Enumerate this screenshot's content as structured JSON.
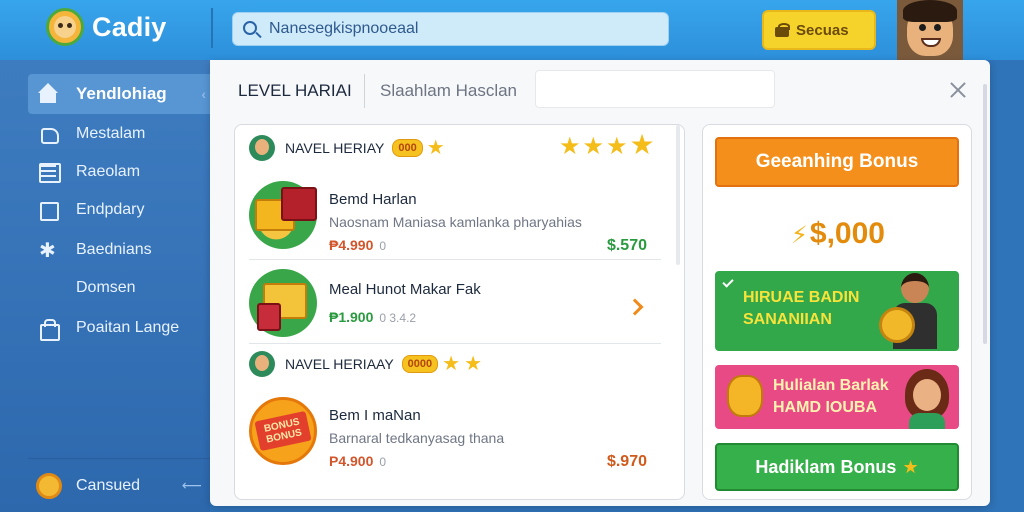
{
  "header": {
    "app_title": "Cadiy",
    "search_value": "Nanesegkispnooeaal",
    "bonus_label": "Secuas",
    "icons": [
      "app-logo-icon",
      "search-icon",
      "gift-icon",
      "avatar"
    ]
  },
  "sidebar": {
    "items": [
      {
        "label": "Yendlohiag",
        "icon": "home-icon",
        "active": true
      },
      {
        "label": "Mestalam",
        "icon": "hand-icon",
        "active": false
      },
      {
        "label": "Raeolam",
        "icon": "list-icon",
        "active": false
      },
      {
        "label": "Endpdary",
        "icon": "square-icon",
        "active": false
      },
      {
        "label": "Baednians",
        "icon": "star-icon",
        "active": false
      },
      {
        "label": "Domsen",
        "icon": "",
        "active": false
      },
      {
        "label": "Poaitan Lange",
        "icon": "bag-icon",
        "active": false
      }
    ],
    "footer_label": "Cansued"
  },
  "dialog": {
    "tabs": [
      {
        "label": "LEVEL HARIAI",
        "active": true
      },
      {
        "label": "Slaahlam Hasclan",
        "active": false
      }
    ]
  },
  "offers_panel": {
    "level_1": {
      "label": "NAVEL HERIAY",
      "badge": "000",
      "stars_inline": 1,
      "stars_right": 4
    },
    "offer_1": {
      "title": "Bemd Harlan",
      "desc": "Naosnam Maniasa kamlanka pharyahias",
      "price": "₱4.990",
      "price_extra": "0",
      "amount": "$.570"
    },
    "offer_2": {
      "title": "Meal Hunot Makar Fak",
      "price": "₱1.900",
      "price_extra": "0  3.4.2"
    },
    "level_2": {
      "label": "NAVEL HERIAAY",
      "badge": "0000",
      "stars_inline": 2
    },
    "offer_3": {
      "title": "Bem I maNan",
      "desc": "Barnaral tedkanyasag thana",
      "price": "P4.900",
      "price_extra": "0",
      "amount": "$.970",
      "image_label": "BONUS BONUS"
    }
  },
  "bonus_panel": {
    "top_button": "Geeanhing Bonus",
    "amount": "$,000",
    "green_card_lines": [
      "HIRUAE BADIN",
      "SANANIIAN"
    ],
    "pink_card_lines": [
      "Hulialan Barlak",
      "HAMD IOUBA"
    ],
    "bottom_button": "Hadiklam Bonus"
  },
  "colors": {
    "topbar": "#2d8fda",
    "sidebar": "#2d68ad",
    "accent_orange": "#f58f1c",
    "accent_green": "#35b04a",
    "accent_pink": "#e84a86",
    "star": "#f4bd1a"
  }
}
